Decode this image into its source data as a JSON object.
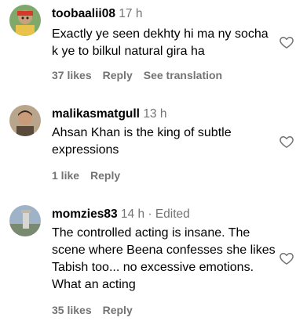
{
  "comments": [
    {
      "username": "toobaalii08",
      "time": "17 h",
      "edited": "",
      "text": "Exactly ye seen dekhty hi ma ny socha k ye to bilkul natural gira ha",
      "likes": "37 likes",
      "reply": "Reply",
      "translate": "See translation"
    },
    {
      "username": "malikasmatgull",
      "time": "13 h",
      "edited": "",
      "text": "Ahsan Khan is the king of subtle expressions",
      "likes": "1 like",
      "reply": "Reply"
    },
    {
      "username": "momzies83",
      "time": "14 h",
      "edited": "· Edited",
      "text": "The controlled acting is insane. The scene where Beena confesses she likes Tabish too... no excessive emotions. What an acting",
      "likes": "35 likes",
      "reply": "Reply"
    }
  ],
  "icons": {
    "like": "heart-outline-icon"
  },
  "colors": {
    "text": "#000000",
    "secondary": "#737373",
    "background": "#ffffff"
  }
}
